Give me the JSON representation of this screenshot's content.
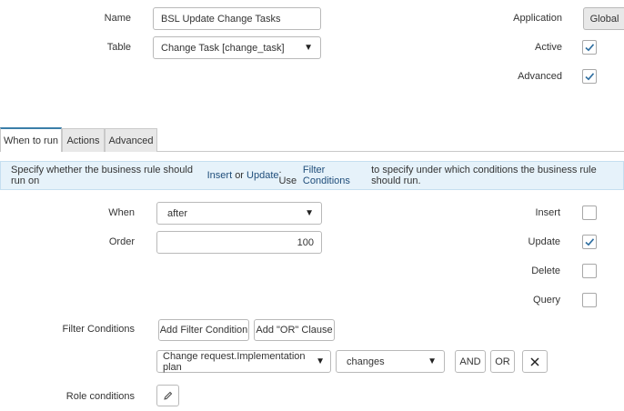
{
  "form": {
    "name_label": "Name",
    "name_value": "BSL Update Change Tasks",
    "table_label": "Table",
    "table_value": "Change Task [change_task]",
    "application_label": "Application",
    "application_value": "Global",
    "active_label": "Active",
    "active_checked": true,
    "advanced_label": "Advanced",
    "advanced_checked": true
  },
  "tabs": [
    {
      "label": "When to run",
      "active": true
    },
    {
      "label": "Actions",
      "active": false
    },
    {
      "label": "Advanced",
      "active": false
    }
  ],
  "info": {
    "part1": "Specify whether the business rule should run on ",
    "insert": "Insert",
    "part2": " or ",
    "update": "Update",
    "part3": ". Use ",
    "filter": "Filter Conditions",
    "part4": " to specify under which conditions the business rule should run."
  },
  "when_to_run": {
    "when_label": "When",
    "when_value": "after",
    "order_label": "Order",
    "order_value": "100",
    "insert_label": "Insert",
    "insert_checked": false,
    "update_label": "Update",
    "update_checked": true,
    "delete_label": "Delete",
    "delete_checked": false,
    "query_label": "Query",
    "query_checked": false,
    "filter_label": "Filter Conditions",
    "add_filter_label": "Add Filter Condition",
    "add_or_label": "Add \"OR\" Clause",
    "condition_field": "Change request.Implementation plan",
    "condition_operator": "changes",
    "and_label": "AND",
    "or_label": "OR",
    "role_label": "Role conditions"
  },
  "colors": {
    "check": "#2e6ea0",
    "tab_accent": "#3b7ea9",
    "info_bg": "#e6f2fa"
  }
}
